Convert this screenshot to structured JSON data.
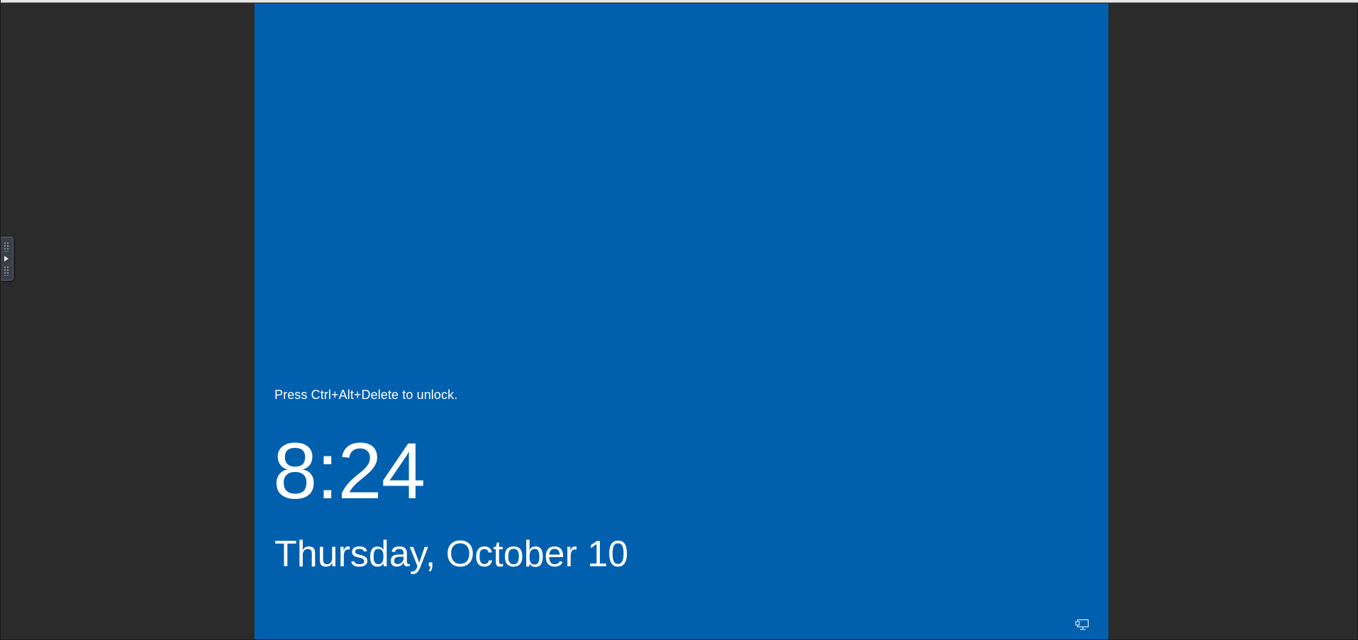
{
  "lock_screen": {
    "unlock_hint": "Press Ctrl+Alt+Delete to unlock.",
    "time": "8:24",
    "date": "Thursday, October 10",
    "background_color": "#0060ae",
    "network_icon": "network-monitor-icon"
  },
  "viewer": {
    "background_color": "#2b2b2b",
    "side_handle_icon": "expand-arrow-icon"
  }
}
